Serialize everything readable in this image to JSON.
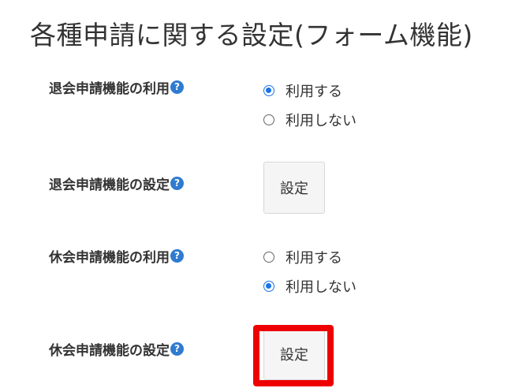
{
  "title": "各種申請に関する設定(フォーム機能)",
  "help_glyph": "?",
  "rows": [
    {
      "label": "退会申請機能の利用",
      "type": "radio",
      "options": [
        {
          "label": "利用する",
          "checked": true
        },
        {
          "label": "利用しない",
          "checked": false
        }
      ]
    },
    {
      "label": "退会申請機能の設定",
      "type": "button",
      "button_label": "設定"
    },
    {
      "label": "休会申請機能の利用",
      "type": "radio",
      "options": [
        {
          "label": "利用する",
          "checked": false
        },
        {
          "label": "利用しない",
          "checked": true
        }
      ]
    },
    {
      "label": "休会申請機能の設定",
      "type": "button",
      "button_label": "設定",
      "highlighted": true
    }
  ],
  "colors": {
    "radio_checked": "#1a73e8",
    "help_icon": "#2f7bd0",
    "highlight": "#ee0000"
  }
}
